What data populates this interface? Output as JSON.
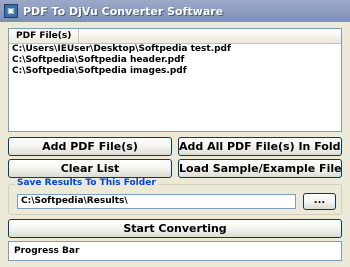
{
  "window": {
    "title": "PDF To DjVu Converter Software",
    "icon": "app-icon"
  },
  "file_list": {
    "column_header": "PDF File(s)",
    "items": [
      "C:\\Users\\IEUser\\Desktop\\Softpedia test.pdf",
      "C:\\Softpedia\\Softpedia header.pdf",
      "C:\\Softpedia\\Softpedia images.pdf"
    ]
  },
  "buttons": {
    "add_files": "Add PDF File(s)",
    "add_folder": "Add All PDF File(s) In Folder",
    "clear_list": "Clear List",
    "load_samples": "Load Sample/Example Files",
    "browse": "...",
    "start": "Start Converting"
  },
  "save_folder": {
    "label": "Save Results To This Folder",
    "value": "C:\\Softpedia\\Results\\"
  },
  "progress": {
    "label": "Progress Bar"
  }
}
